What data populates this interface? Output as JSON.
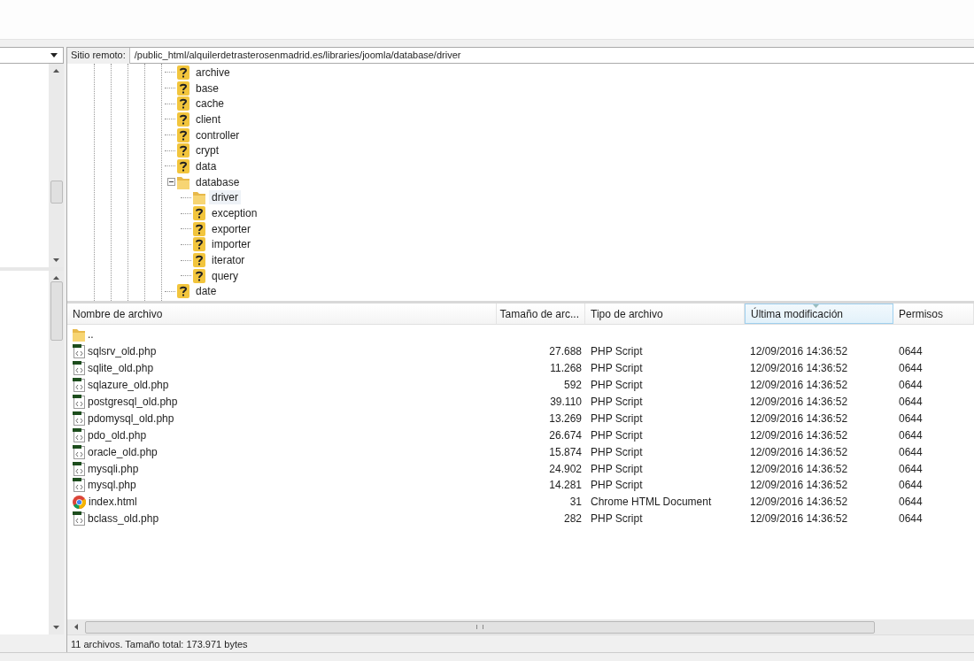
{
  "remote_site": {
    "label": "Sitio remoto:",
    "path": "/public_html/alquilerdetrasterosenmadrid.es/libraries/joomla/database/driver"
  },
  "tree": [
    {
      "name": "archive",
      "kind": "unknown",
      "selected": false
    },
    {
      "name": "base",
      "kind": "unknown",
      "selected": false
    },
    {
      "name": "cache",
      "kind": "unknown",
      "selected": false
    },
    {
      "name": "client",
      "kind": "unknown",
      "selected": false
    },
    {
      "name": "controller",
      "kind": "unknown",
      "selected": false
    },
    {
      "name": "crypt",
      "kind": "unknown",
      "selected": false
    },
    {
      "name": "data",
      "kind": "unknown",
      "selected": false
    },
    {
      "name": "database",
      "kind": "folder",
      "selected": false,
      "expanded": true,
      "children": [
        {
          "name": "driver",
          "kind": "folder",
          "selected": true
        },
        {
          "name": "exception",
          "kind": "unknown",
          "selected": false
        },
        {
          "name": "exporter",
          "kind": "unknown",
          "selected": false
        },
        {
          "name": "importer",
          "kind": "unknown",
          "selected": false
        },
        {
          "name": "iterator",
          "kind": "unknown",
          "selected": false
        },
        {
          "name": "query",
          "kind": "unknown",
          "selected": false
        }
      ]
    },
    {
      "name": "date",
      "kind": "unknown",
      "selected": false
    }
  ],
  "file_list": {
    "columns": [
      {
        "label": "Nombre de archivo",
        "sorted": false
      },
      {
        "label": "Tamaño de arc...",
        "sorted": false
      },
      {
        "label": "Tipo de archivo",
        "sorted": false
      },
      {
        "label": "Última modificación",
        "sorted": true
      },
      {
        "label": "Permisos",
        "sorted": false
      }
    ],
    "rows": [
      {
        "name": "..",
        "kind": "folder"
      },
      {
        "name": "sqlsrv_old.php",
        "kind": "php",
        "size": "27.688",
        "type": "PHP Script",
        "modified": "12/09/2016 14:36:52",
        "permissions": "0644"
      },
      {
        "name": "sqlite_old.php",
        "kind": "php",
        "size": "11.268",
        "type": "PHP Script",
        "modified": "12/09/2016 14:36:52",
        "permissions": "0644"
      },
      {
        "name": "sqlazure_old.php",
        "kind": "php",
        "size": "592",
        "type": "PHP Script",
        "modified": "12/09/2016 14:36:52",
        "permissions": "0644"
      },
      {
        "name": "postgresql_old.php",
        "kind": "php",
        "size": "39.110",
        "type": "PHP Script",
        "modified": "12/09/2016 14:36:52",
        "permissions": "0644"
      },
      {
        "name": "pdomysql_old.php",
        "kind": "php",
        "size": "13.269",
        "type": "PHP Script",
        "modified": "12/09/2016 14:36:52",
        "permissions": "0644"
      },
      {
        "name": "pdo_old.php",
        "kind": "php",
        "size": "26.674",
        "type": "PHP Script",
        "modified": "12/09/2016 14:36:52",
        "permissions": "0644"
      },
      {
        "name": "oracle_old.php",
        "kind": "php",
        "size": "15.874",
        "type": "PHP Script",
        "modified": "12/09/2016 14:36:52",
        "permissions": "0644"
      },
      {
        "name": "mysqli.php",
        "kind": "php",
        "size": "24.902",
        "type": "PHP Script",
        "modified": "12/09/2016 14:36:52",
        "permissions": "0644"
      },
      {
        "name": "mysql.php",
        "kind": "php",
        "size": "14.281",
        "type": "PHP Script",
        "modified": "12/09/2016 14:36:52",
        "permissions": "0644"
      },
      {
        "name": "index.html",
        "kind": "html",
        "size": "31",
        "type": "Chrome HTML Document",
        "modified": "12/09/2016 14:36:52",
        "permissions": "0644"
      },
      {
        "name": "bclass_old.php",
        "kind": "php",
        "size": "282",
        "type": "PHP Script",
        "modified": "12/09/2016 14:36:52",
        "permissions": "0644"
      }
    ]
  },
  "status_bar": "11 archivos. Tamaño total: 173.971 bytes"
}
